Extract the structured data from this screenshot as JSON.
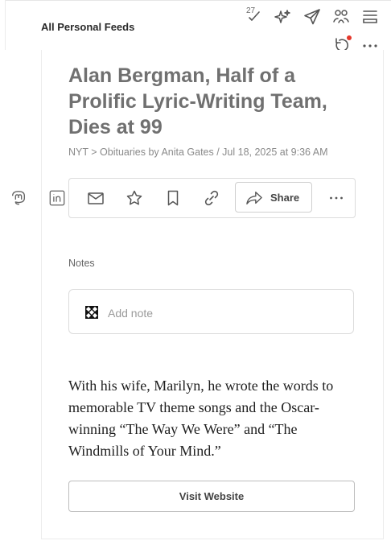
{
  "header": {
    "feed_title": "All Personal Feeds",
    "unread_count": "27",
    "icons": [
      "mark-all-read-icon",
      "ai-sparkle-icon",
      "send-icon",
      "people-icon",
      "layout-icon",
      "refresh-icon",
      "more-options-icon"
    ]
  },
  "article": {
    "headline": "Alan Bergman, Half of a Prolific Lyric-Writing Team, Dies at 99",
    "byline": "NYT > Obituaries by Anita Gates / Jul 18, 2025 at 9:36 AM",
    "summary": "With his wife, Marilyn, he wrote the words to memorable TV theme songs and the Oscar-winning “The Way We Were” and “The Windmills of Your Mind.”"
  },
  "side_share": [
    "mastodon-icon",
    "linkedin-icon"
  ],
  "actions": {
    "share_label": "Share",
    "icons": [
      "email-icon",
      "star-icon",
      "bookmark-icon",
      "link-icon",
      "share-icon",
      "more-icon"
    ]
  },
  "notes": {
    "label": "Notes",
    "placeholder": "Add note"
  },
  "visit_label": "Visit Website",
  "colors": {
    "headline": "#707070",
    "notification_dot": "#e5372b",
    "border": "#dcdcdc"
  }
}
